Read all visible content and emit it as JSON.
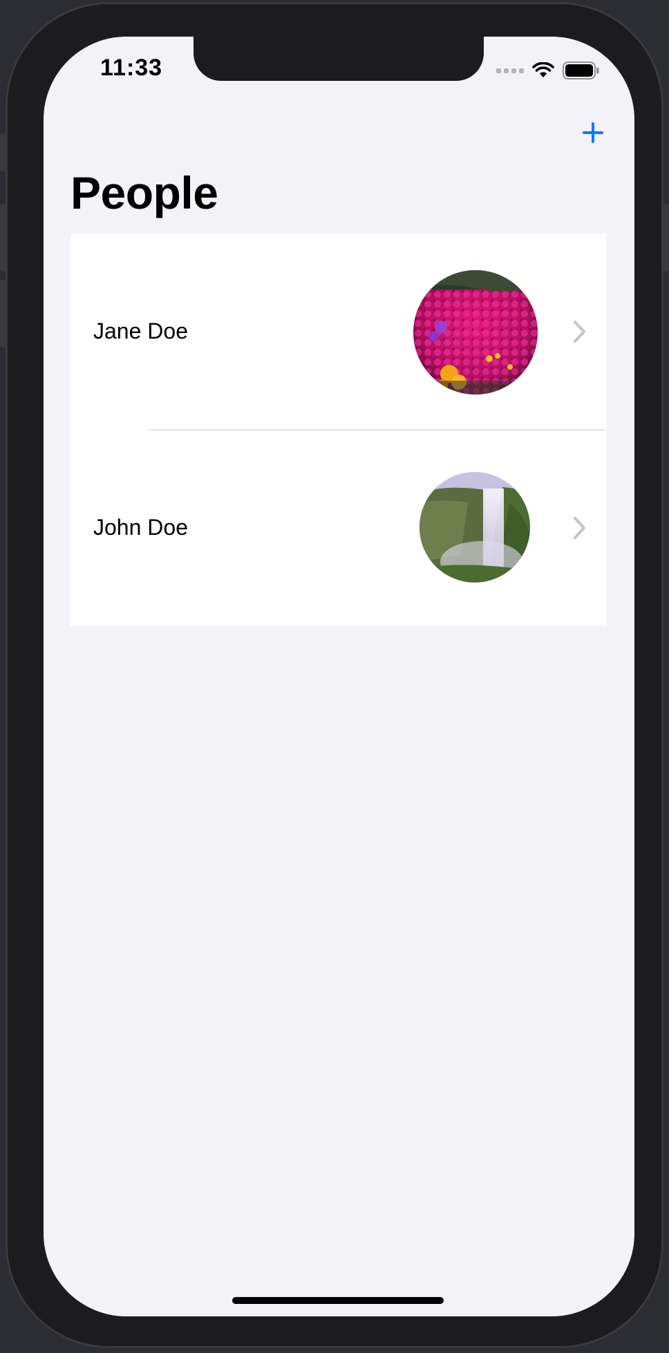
{
  "status_bar": {
    "time": "11:33"
  },
  "nav": {
    "title": "People",
    "add_icon": "plus-icon",
    "accent_color": "#0a7aff"
  },
  "people": [
    {
      "name": "Jane Doe",
      "avatar": "flowers-photo"
    },
    {
      "name": "John Doe",
      "avatar": "waterfall-photo"
    }
  ],
  "row_chevron_icon": "chevron-right-icon"
}
